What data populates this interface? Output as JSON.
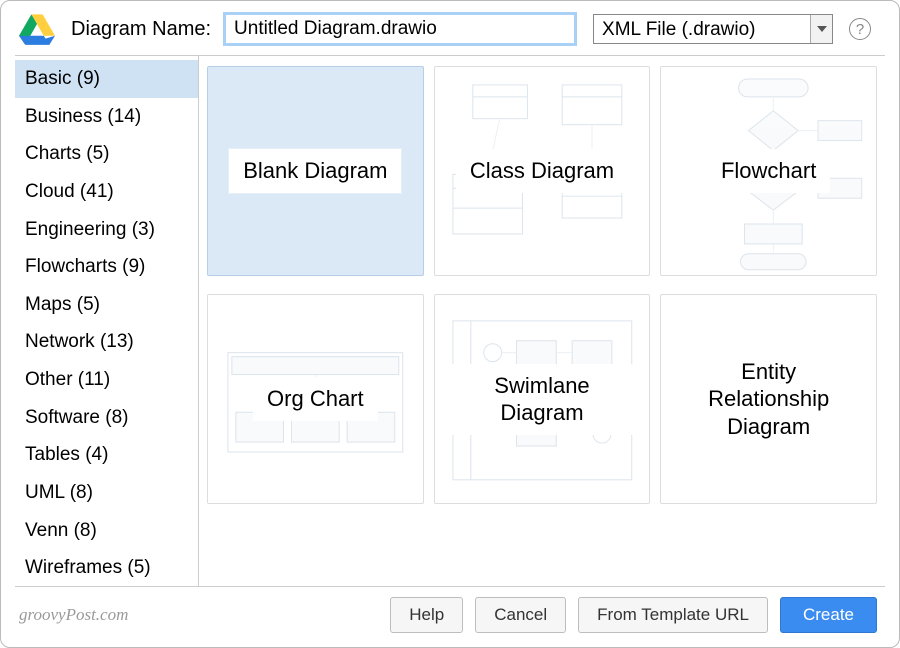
{
  "header": {
    "name_label": "Diagram Name:",
    "name_value": "Untitled Diagram.drawio",
    "format_selected": "XML File (.drawio)",
    "help_glyph": "?"
  },
  "sidebar": {
    "items": [
      {
        "label": "Basic (9)",
        "selected": true
      },
      {
        "label": "Business (14)"
      },
      {
        "label": "Charts (5)"
      },
      {
        "label": "Cloud (41)"
      },
      {
        "label": "Engineering (3)"
      },
      {
        "label": "Flowcharts (9)"
      },
      {
        "label": "Maps (5)"
      },
      {
        "label": "Network (13)"
      },
      {
        "label": "Other (11)"
      },
      {
        "label": "Software (8)"
      },
      {
        "label": "Tables (4)"
      },
      {
        "label": "UML (8)"
      },
      {
        "label": "Venn (8)"
      },
      {
        "label": "Wireframes (5)"
      }
    ]
  },
  "templates": [
    {
      "label": "Blank Diagram",
      "selected": true
    },
    {
      "label": "Class Diagram"
    },
    {
      "label": "Flowchart"
    },
    {
      "label": "Org Chart"
    },
    {
      "label": "Swimlane Diagram"
    },
    {
      "label": "Entity Relationship Diagram"
    }
  ],
  "footer": {
    "watermark": "groovyPost.com",
    "help": "Help",
    "cancel": "Cancel",
    "from_url": "From Template URL",
    "create": "Create"
  },
  "colors": {
    "primary": "#3b8cf0",
    "selection": "#dbe9f7"
  }
}
